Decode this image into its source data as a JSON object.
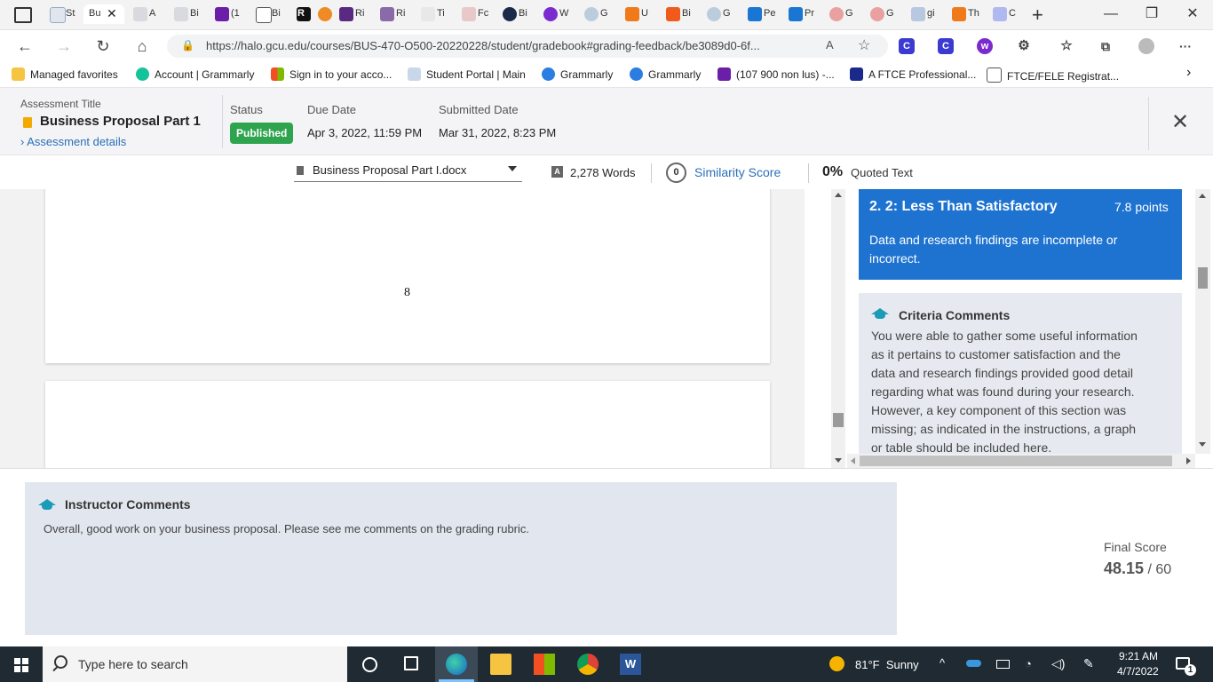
{
  "browser": {
    "active_tab_label": "Bu",
    "tab_labels": [
      "St",
      "A",
      "Bi",
      "(1",
      "Bi",
      "R",
      "Ri",
      "Ti",
      "Fc",
      "Bi",
      "W",
      "G",
      "U",
      "Bi",
      "G",
      "Pe",
      "Pr",
      "G",
      "G",
      "gi",
      "Th",
      "C"
    ],
    "url": "https://halo.gcu.edu/courses/BUS-470-O500-20220228/student/gradebook#grading-feedback/be3089d0-6f...",
    "favorites": [
      "Managed favorites",
      "Account | Grammarly",
      "Sign in to your acco...",
      "Student Portal | Main",
      "Grammarly",
      "Grammarly",
      "(107 900 non lus) -...",
      "A FTCE Professional...",
      "FTCE/FELE Registrat..."
    ]
  },
  "assessment": {
    "title_label": "Assessment Title",
    "title": "Business Proposal Part 1",
    "details_link": "Assessment details",
    "status_label": "Status",
    "status": "Published",
    "due_label": "Due Date",
    "due": "Apr 3, 2022, 11:59 PM",
    "submitted_label": "Submitted Date",
    "submitted": "Mar 31, 2022, 8:23 PM"
  },
  "toolbar": {
    "file": "Business Proposal Part I.docx",
    "words": "2,278 Words",
    "similarity_count": "0",
    "similarity_label": "Similarity Score",
    "quoted_pct": "0%",
    "quoted_label": "Quoted Text"
  },
  "document": {
    "page_number": "8"
  },
  "rubric": {
    "level": "2. 2: Less Than Satisfactory",
    "points": "7.8 points",
    "level_desc": "Data and research findings are incomplete or incorrect.",
    "comments_title": "Criteria Comments",
    "comments_lines": [
      "You were able to gather some useful information",
      "as it pertains to customer satisfaction and the",
      "data and research findings provided good detail",
      "regarding what was found during your research.",
      "However, a key component of this section was",
      "missing; as indicated in the instructions, a graph",
      "or table should be included here."
    ]
  },
  "instructor": {
    "title": "Instructor Comments",
    "text": "Overall, good work on your business proposal. Please see me comments on the grading rubric."
  },
  "score": {
    "label": "Final Score",
    "value": "48.15",
    "total": "/ 60"
  },
  "taskbar": {
    "search_placeholder": "Type here to search",
    "weather": "81°F  Sunny",
    "time": "9:21 AM",
    "date": "4/7/2022",
    "notifications": "1"
  },
  "colors": {
    "accent_blue": "#1e73d0",
    "published_green": "#2ea44f",
    "link_blue": "#2a6fb8",
    "teal_icon": "#1b9bb5"
  }
}
